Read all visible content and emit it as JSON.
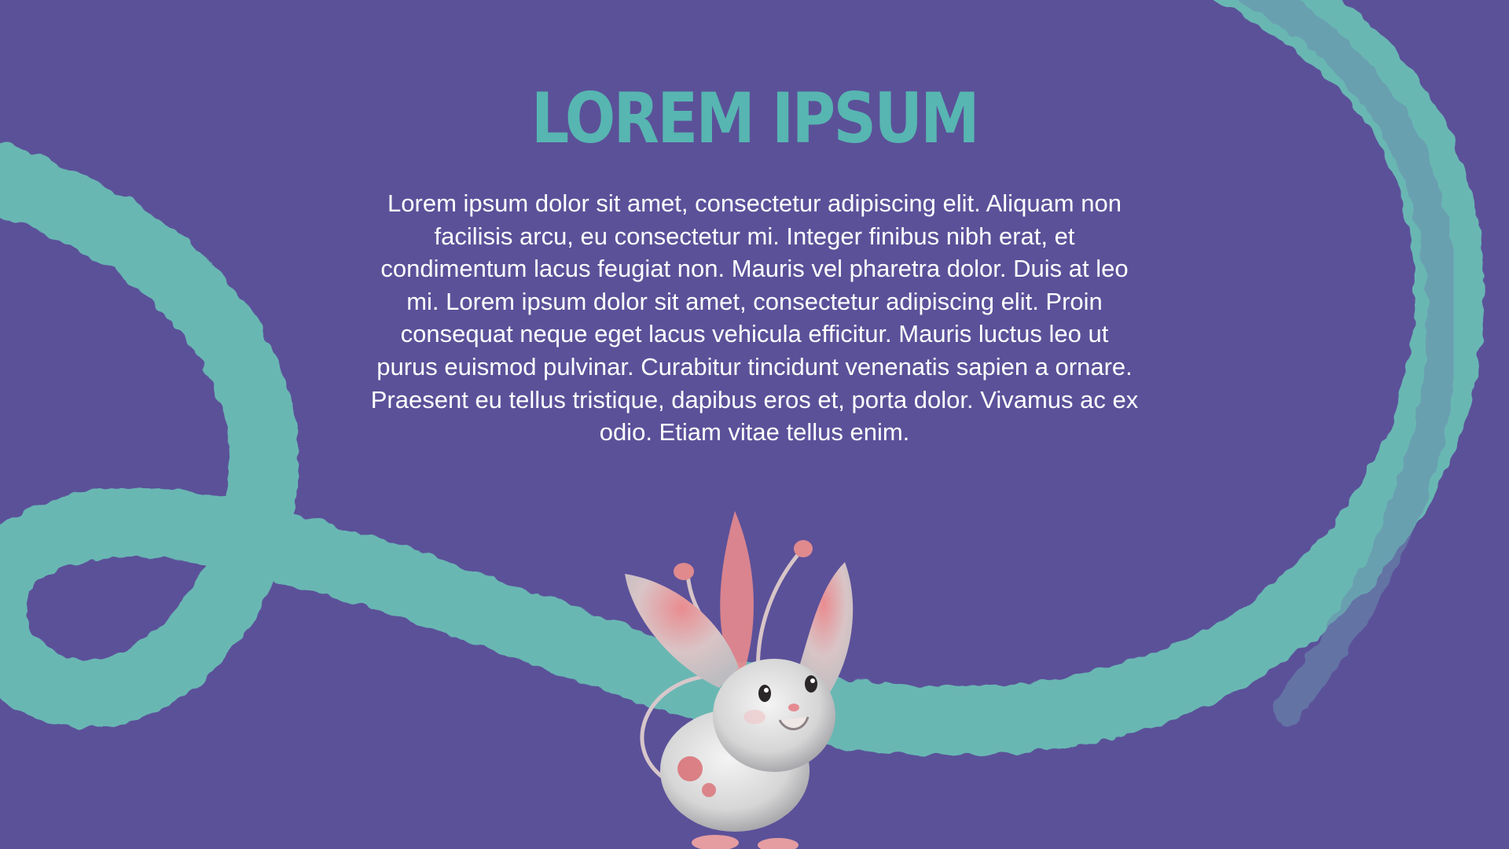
{
  "slide": {
    "title": "LOREM IPSUM",
    "body": "Lorem ipsum dolor sit amet, consectetur adipiscing elit. Aliquam non facilisis arcu, eu consectetur mi. Integer finibus nibh erat, et condimentum lacus feugiat non. Mauris vel pharetra dolor. Duis at leo mi. Lorem ipsum dolor sit amet, consectetur adipiscing elit. Proin consequat neque eget lacus vehicula efficitur. Mauris luctus leo ut purus euismod pulvinar. Curabitur tincidunt venenatis sapien a ornare. Praesent eu tellus tristique, dapibus eros et, porta dolor. Vivamus ac ex odio. Etiam vitae tellus enim."
  },
  "colors": {
    "background": "#5b5199",
    "ribbon": "#69b7b3",
    "title": "#57b6b1",
    "body_text": "#ffffff",
    "creature_fur": "#dcdcdc",
    "creature_accent": "#e68a8e"
  },
  "illustration": {
    "ribbon": "teal-brush-ribbon",
    "character": "winged-mouse-creature"
  }
}
